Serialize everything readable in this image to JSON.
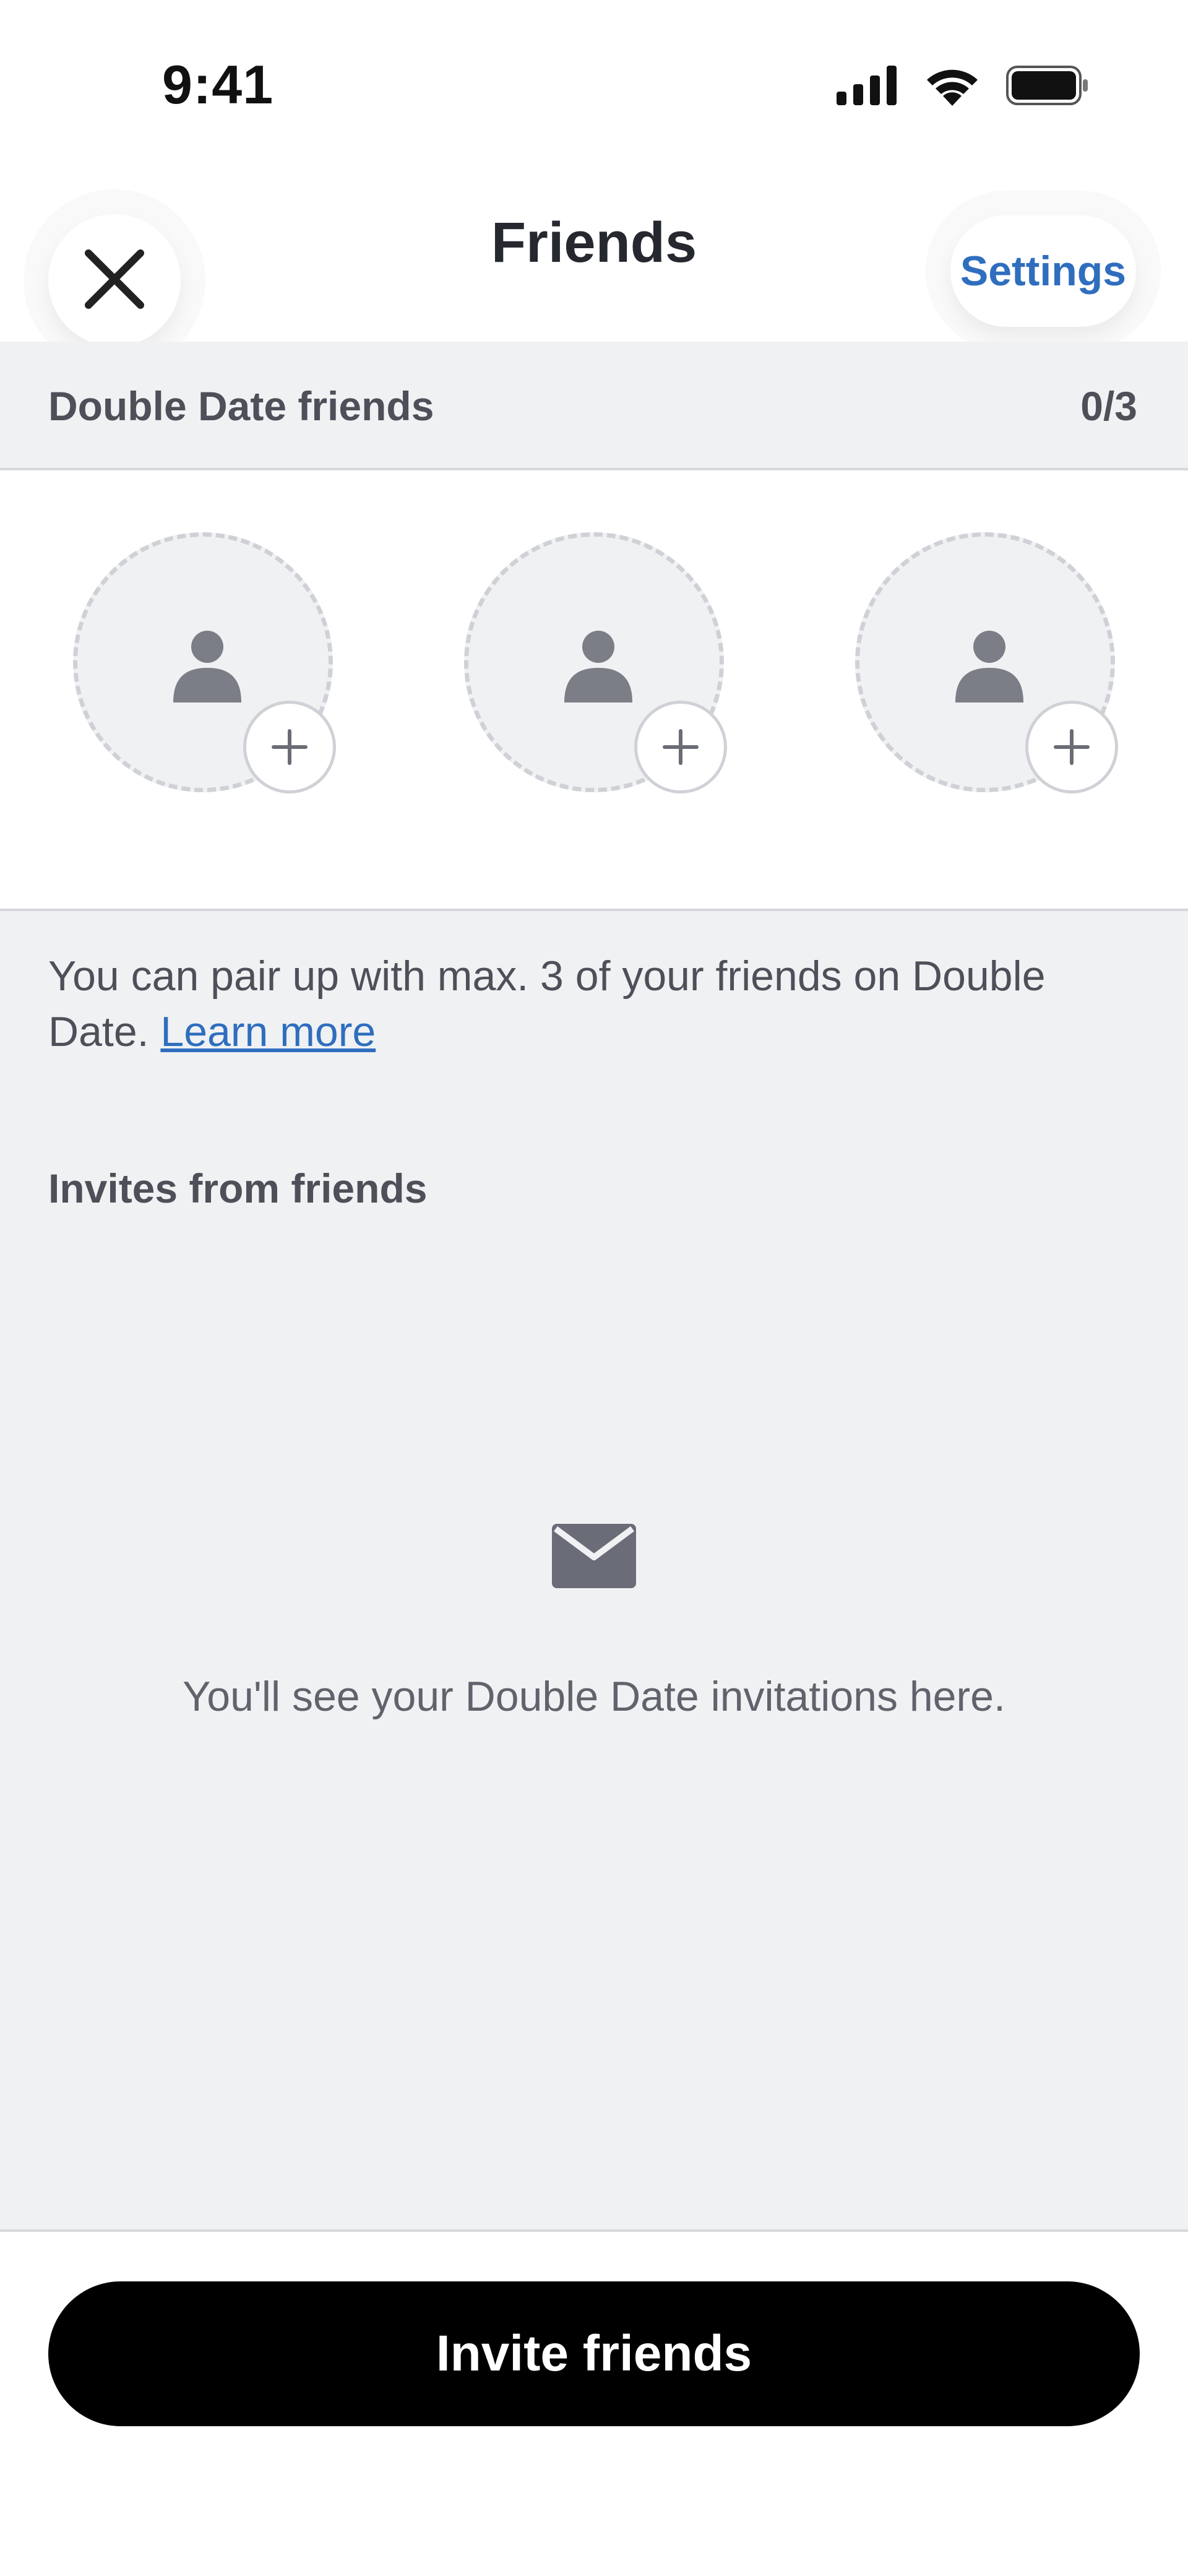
{
  "status_bar": {
    "time": "9:41",
    "icons": [
      "signal-icon",
      "wifi-icon",
      "battery-icon"
    ]
  },
  "header": {
    "close_icon": "close-icon",
    "title": "Friends",
    "settings_label": "Settings"
  },
  "section": {
    "title": "Double Date friends",
    "count": "0/3"
  },
  "slots": [
    {
      "icon": "person-icon",
      "action_icon": "plus-icon"
    },
    {
      "icon": "person-icon",
      "action_icon": "plus-icon"
    },
    {
      "icon": "person-icon",
      "action_icon": "plus-icon"
    }
  ],
  "info": {
    "text": "You can pair up with max. 3 of your friends on Double Date.",
    "link": "Learn more"
  },
  "invites": {
    "title": "Invites from friends",
    "empty_icon": "mail-icon",
    "empty_text": "You'll see your Double Date invitations here."
  },
  "footer": {
    "invite_label": "Invite friends"
  },
  "colors": {
    "accent": "#2f6ebe",
    "background_grey": "#f0f1f3",
    "text_dark": "#262830",
    "text_muted": "#4d5058",
    "button_bg": "#000000"
  }
}
